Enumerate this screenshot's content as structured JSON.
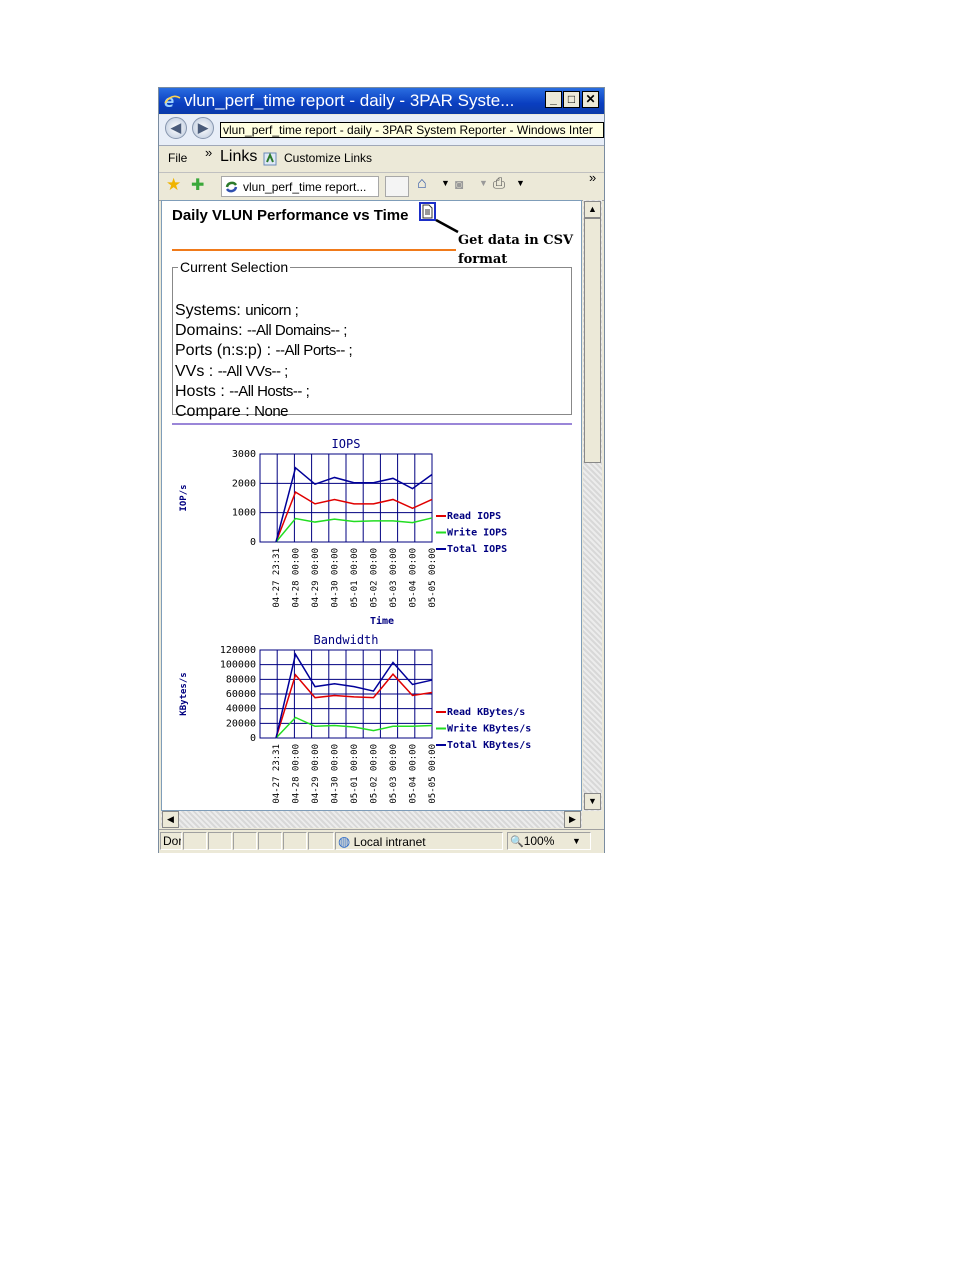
{
  "window": {
    "title": "vlun_perf_time report - daily - 3PAR Syste...",
    "tooltip": "vlun_perf_time report - daily - 3PAR System Reporter - Windows Inter"
  },
  "menu": {
    "file": "File",
    "chevron": "»",
    "links": "Links",
    "customize_links": "Customize Links"
  },
  "favorites": {
    "tab_label": "vlun_perf_time report...",
    "chevron": "»"
  },
  "page": {
    "title": "Daily VLUN Performance vs Time",
    "selection_legend": "Current Selection",
    "selection": [
      {
        "label": "Systems:",
        "value": "unicorn ;"
      },
      {
        "label": "Domains:",
        "value": "--All Domains-- ;"
      },
      {
        "label": "Ports (n:s:p) :",
        "value": "--All Ports-- ;"
      },
      {
        "label": "VVs :",
        "value": "--All VVs-- ;"
      },
      {
        "label": "Hosts :",
        "value": "--All Hosts-- ;"
      },
      {
        "label": "Compare :",
        "value": "None"
      }
    ]
  },
  "annotation": {
    "line1": "Get data in CSV",
    "line2": "format"
  },
  "status": {
    "text": "Dor",
    "zone": "Local intranet",
    "zoom": "100%"
  },
  "colors": {
    "read": "#e00000",
    "write": "#22dd22",
    "total": "#000099",
    "grid": "#000080",
    "title_bar": "#0a3ec0"
  },
  "icons": {
    "ie": "ie-logo-icon",
    "csv": "document-icon",
    "home": "home-icon",
    "rss": "rss-icon",
    "print": "print-icon",
    "star": "star-icon",
    "add_fav": "add-favorite-icon",
    "zone": "globe-icon",
    "zoom": "zoom-icon"
  },
  "chart_data": [
    {
      "type": "line",
      "title": "IOPS",
      "xlabel": "Time",
      "ylabel": "IOP/s",
      "ylim": [
        0,
        3000
      ],
      "yticks": [
        "0",
        "1000",
        "2000",
        "3000"
      ],
      "categories": [
        "04-27 23:31",
        "04-28 00:00",
        "04-29 00:00",
        "04-30 00:00",
        "05-01 00:00",
        "05-02 00:00",
        "05-03 00:00",
        "05-04 00:00",
        "05-05 00:00"
      ],
      "series": [
        {
          "name": "Read IOPS",
          "color": "#e00000",
          "values": [
            0,
            1700,
            1300,
            1450,
            1300,
            1300,
            1450,
            1150,
            1450
          ]
        },
        {
          "name": "Write IOPS",
          "color": "#22dd22",
          "values": [
            0,
            800,
            680,
            780,
            700,
            720,
            720,
            660,
            820
          ]
        },
        {
          "name": "Total IOPS",
          "color": "#000099",
          "values": [
            0,
            2530,
            1970,
            2200,
            2020,
            2020,
            2170,
            1820,
            2300
          ]
        }
      ]
    },
    {
      "type": "line",
      "title": "Bandwidth",
      "xlabel": "",
      "ylabel": "KBytes/s",
      "ylim": [
        0,
        120000
      ],
      "yticks": [
        "0",
        "20000",
        "40000",
        "60000",
        "80000",
        "100000",
        "120000"
      ],
      "categories": [
        "04-27 23:31",
        "04-28 00:00",
        "04-29 00:00",
        "04-30 00:00",
        "05-01 00:00",
        "05-02 00:00",
        "05-03 00:00",
        "05-04 00:00",
        "05-05 00:00"
      ],
      "series": [
        {
          "name": "Read KBytes/s",
          "color": "#e00000",
          "values": [
            0,
            86000,
            55000,
            58000,
            56000,
            55000,
            87000,
            58000,
            62000
          ]
        },
        {
          "name": "Write KBytes/s",
          "color": "#22dd22",
          "values": [
            0,
            28000,
            16000,
            17000,
            15000,
            10000,
            16000,
            16000,
            17000
          ]
        },
        {
          "name": "Total KBytes/s",
          "color": "#000099",
          "values": [
            0,
            114000,
            70000,
            74000,
            70000,
            64000,
            103000,
            73000,
            79000
          ]
        }
      ]
    }
  ]
}
